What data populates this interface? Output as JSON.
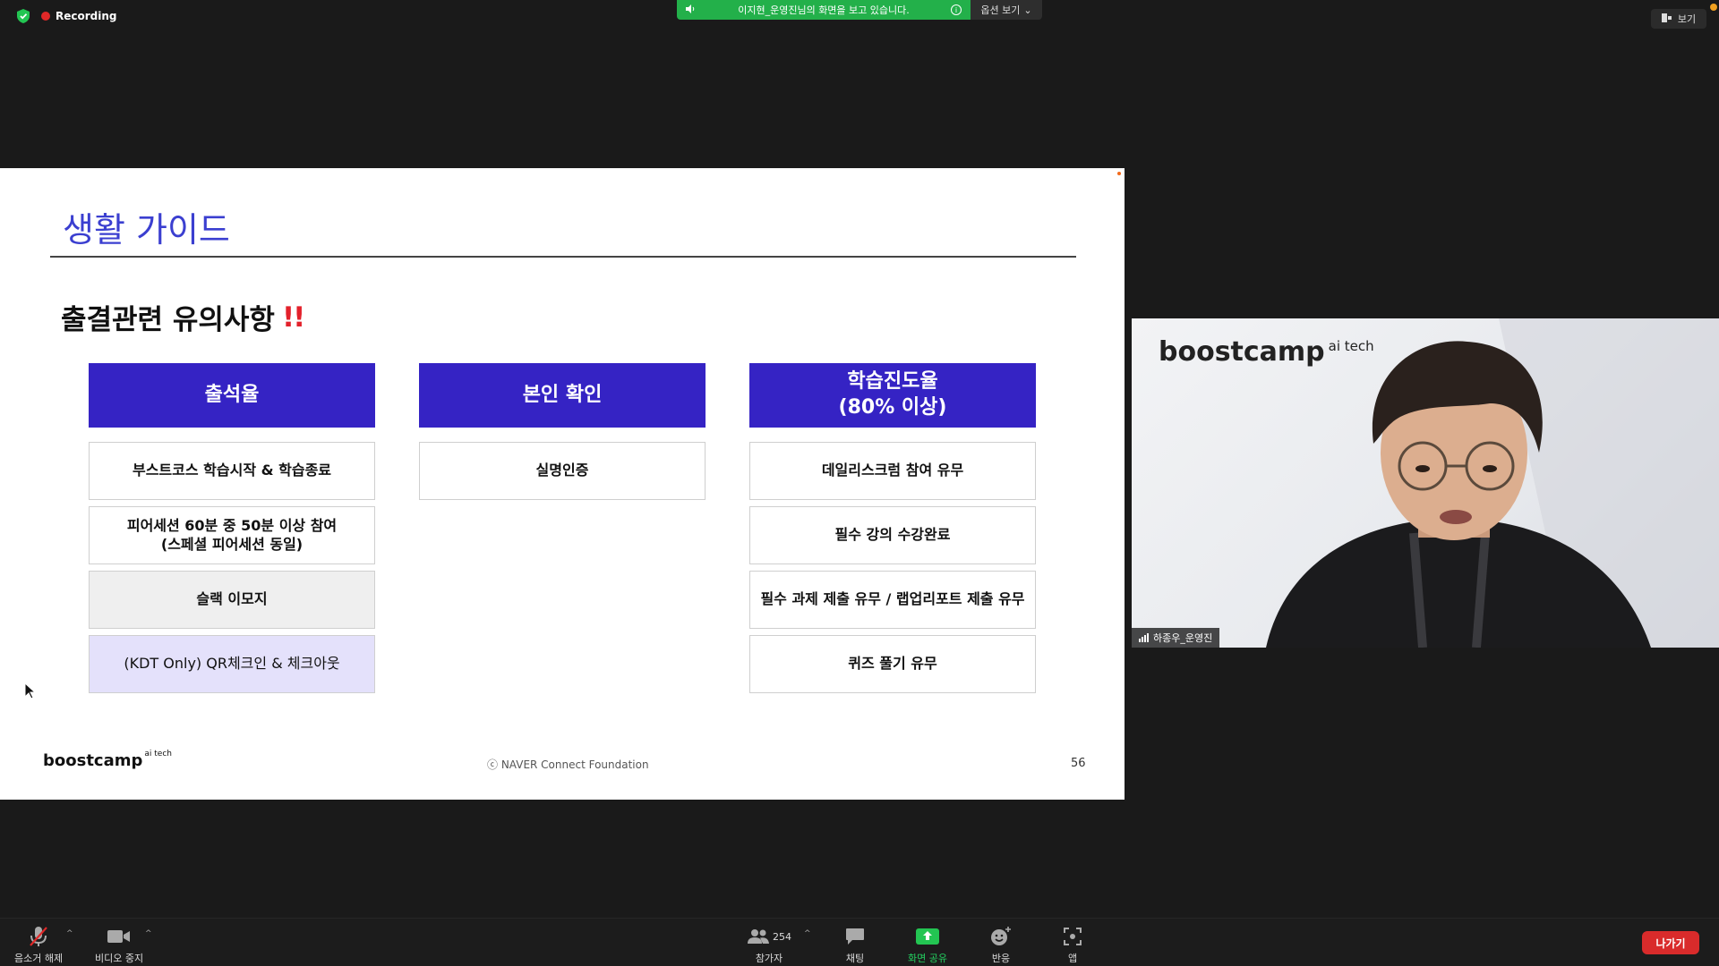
{
  "top": {
    "recording_label": "Recording",
    "share_banner_text": "이지현_운영진님의 화면을 보고 있습니다.",
    "options_label": "옵션 보기",
    "view_label": "보기"
  },
  "slide": {
    "title": "생활 가이드",
    "subtitle": "출결관련 유의사항",
    "subtitle_mark": "!!",
    "columns": [
      {
        "header": "출석율",
        "cells": [
          {
            "text": "부스트코스 학습시작 & 학습종료",
            "style": "plain"
          },
          {
            "text": "피어세션 60분 중 50분 이상 참여\n(스페셜 피어세션 동일)",
            "style": "plain"
          },
          {
            "text": "슬랙 이모지",
            "style": "gray"
          },
          {
            "text": "(KDT Only) QR체크인 & 체크아웃",
            "style": "lavender"
          }
        ]
      },
      {
        "header": "본인 확인",
        "cells": [
          {
            "text": "실명인증",
            "style": "plain"
          }
        ]
      },
      {
        "header": "학습진도율\n(80% 이상)",
        "cells": [
          {
            "text": "데일리스크럼 참여 유무",
            "style": "plain"
          },
          {
            "text": "필수 강의 수강완료",
            "style": "plain"
          },
          {
            "text": "필수 과제 제출 유무 / 랩업리포트 제출 유무",
            "style": "plain"
          },
          {
            "text": "퀴즈 풀기 유무",
            "style": "plain"
          }
        ]
      }
    ],
    "footer_logo": "boostcamp",
    "footer_logo_sup": "ai tech",
    "footer_copyright": "ⓒ  NAVER Connect Foundation",
    "page_number": "56"
  },
  "video": {
    "logo": "boostcamp",
    "logo_sup": "ai tech",
    "participant_name": "하종우_운영진"
  },
  "toolbar": {
    "unmute_label": "음소거 해제",
    "stop_video_label": "비디오 중지",
    "participants_label": "참가자",
    "participants_count": "254",
    "chat_label": "채팅",
    "share_label": "화면 공유",
    "reactions_label": "반응",
    "apps_label": "앱",
    "leave_label": "나가기"
  },
  "colors": {
    "slide_title": "#3b3fd0",
    "column_header": "#3523c4",
    "share_banner": "#23b04a",
    "leave_button": "#d92b2b",
    "share_active": "#23d160"
  }
}
